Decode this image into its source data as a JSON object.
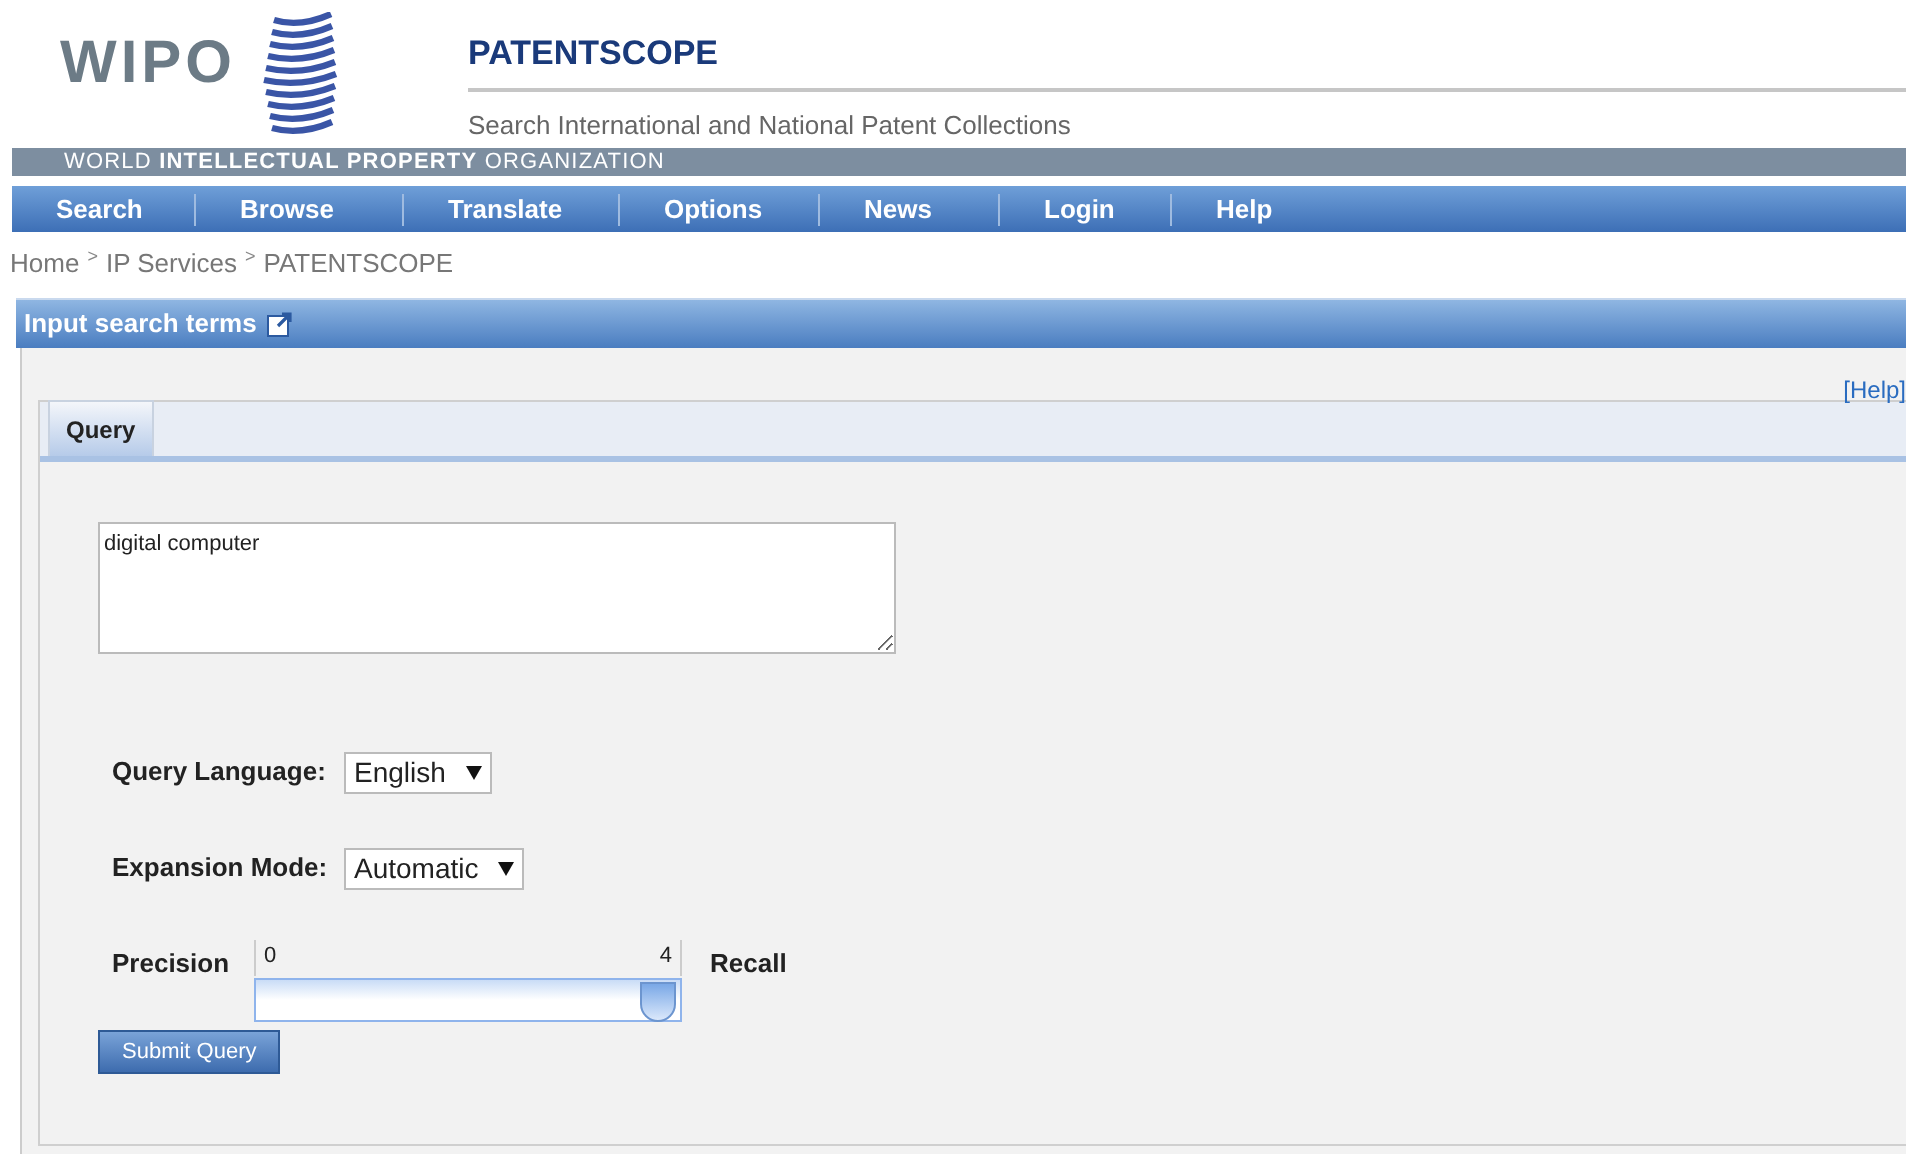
{
  "logo": {
    "text": "WIPO"
  },
  "header": {
    "title": "PATENTSCOPE",
    "subtitle": "Search International and National Patent Collections",
    "org_band": "WORLD **INTELLECTUAL PROPERTY** ORGANIZATION"
  },
  "nav": [
    {
      "label": "Search"
    },
    {
      "label": "Browse"
    },
    {
      "label": "Translate"
    },
    {
      "label": "Options"
    },
    {
      "label": "News"
    },
    {
      "label": "Login"
    },
    {
      "label": "Help"
    }
  ],
  "breadcrumb": [
    {
      "label": "Home"
    },
    {
      "label": "IP Services"
    },
    {
      "label": "PATENTSCOPE"
    }
  ],
  "breadcrumb_separator": ">",
  "panel": {
    "title": "Input search terms",
    "help_link": "[Help]",
    "tabs": [
      {
        "label": "Query",
        "selected": true
      }
    ],
    "query": {
      "value": "digital computer"
    },
    "query_language": {
      "label": "Query Language:",
      "value": "English"
    },
    "expansion_mode": {
      "label": "Expansion Mode:",
      "value": "Automatic"
    },
    "slider": {
      "left_label": "Precision",
      "right_label": "Recall",
      "min": "0",
      "max": "4",
      "level": 1
    },
    "submit": "Submit Query"
  }
}
